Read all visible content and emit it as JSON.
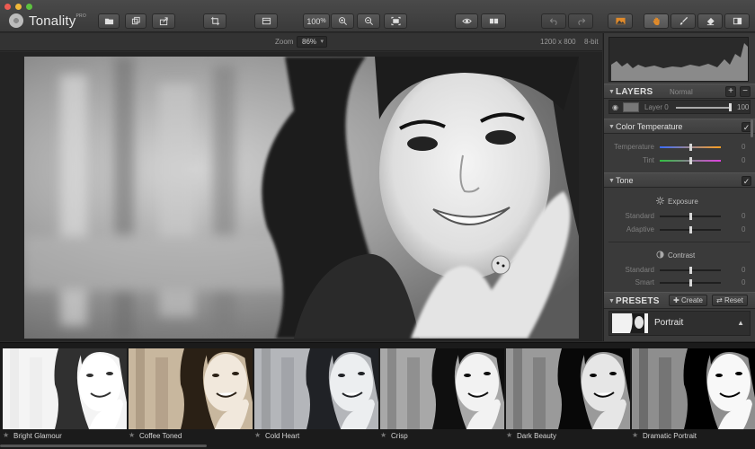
{
  "app": {
    "title": "Tonality",
    "title_mark": "PRO"
  },
  "toolbar": {
    "zoom_level": "100",
    "zoom_percent": "%"
  },
  "infobar": {
    "zoom_label": "Zoom",
    "zoom_value": "86%",
    "dimensions": "1200 x 800",
    "bit_depth": "8-bit"
  },
  "panel": {
    "layers": {
      "title": "LAYERS",
      "blend_mode": "Normal",
      "layer_name": "Layer 0",
      "opacity": "100"
    },
    "color_temperature": {
      "title": "Color Temperature",
      "sliders": [
        {
          "label": "Temperature",
          "value": "0",
          "position": 0.5
        },
        {
          "label": "Tint",
          "value": "0",
          "position": 0.5
        }
      ]
    },
    "tone": {
      "title": "Tone",
      "exposure": {
        "title": "Exposure",
        "sliders": [
          {
            "label": "Standard",
            "value": "0",
            "position": 0.5
          },
          {
            "label": "Adaptive",
            "value": "0",
            "position": 0.5
          }
        ]
      },
      "contrast": {
        "title": "Contrast",
        "sliders": [
          {
            "label": "Standard",
            "value": "0",
            "position": 0.5
          },
          {
            "label": "Smart",
            "value": "0",
            "position": 0.5
          }
        ]
      }
    },
    "presets": {
      "title": "PRESETS",
      "create_label": "Create",
      "reset_label": "Reset",
      "selected": "Portrait"
    }
  },
  "filmstrip": {
    "items": [
      {
        "name": "Bright Glamour"
      },
      {
        "name": "Coffee Toned"
      },
      {
        "name": "Cold Heart"
      },
      {
        "name": "Crisp"
      },
      {
        "name": "Dark Beauty"
      },
      {
        "name": "Dramatic Portrait"
      }
    ]
  },
  "colors": {
    "accent_orange": "#e08a2a",
    "temperature_track": [
      "#3a6cff",
      "#ffa020"
    ],
    "tint_track": [
      "#30c040",
      "#e040e0"
    ]
  }
}
